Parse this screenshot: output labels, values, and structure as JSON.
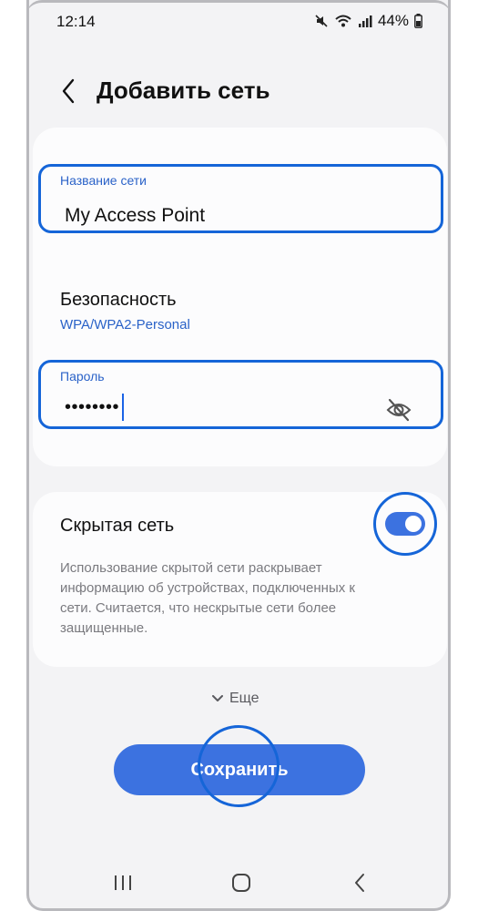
{
  "status_bar": {
    "time": "12:14",
    "battery": "44%",
    "icons": [
      "mute-icon",
      "wifi-icon",
      "signal-icon",
      "battery-icon"
    ]
  },
  "header": {
    "title": "Добавить сеть",
    "back_icon": "chevron-left-icon"
  },
  "network_name": {
    "label": "Название сети",
    "value": "My Access Point"
  },
  "security": {
    "title": "Безопасность",
    "value": "WPA/WPA2-Personal"
  },
  "password": {
    "label": "Пароль",
    "value": "••••••••",
    "visibility_icon": "eye-off-icon"
  },
  "hidden_network": {
    "title": "Скрытая сеть",
    "enabled": true,
    "description": "Использование скрытой сети раскрывает информацию об устройствах, подключенных к сети. Считается, что нескрытые сети более защищенные."
  },
  "more": {
    "label": "Еще",
    "icon": "chevron-down-icon"
  },
  "save_button": {
    "label": "Сохранить"
  },
  "colors": {
    "accent": "#3c72e0",
    "highlight_ring": "#1565d8",
    "link_blue": "#2a62c8",
    "background": "#f3f3f5"
  },
  "navigation": [
    "recents-icon",
    "home-icon",
    "back-icon"
  ]
}
